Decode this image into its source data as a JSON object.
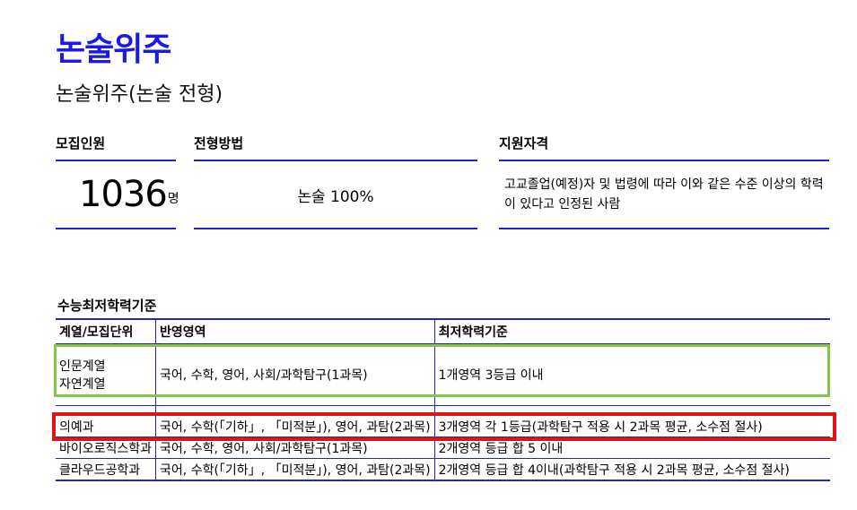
{
  "page": {
    "title": "논술위주",
    "subtitle": "논술위주(논술 전형)"
  },
  "summary": {
    "recruit_label": "모집인원",
    "recruit_count": "1036",
    "recruit_unit": "명",
    "method_label": "전형방법",
    "method_value": "논술 100%",
    "qualification_label": "지원자격",
    "qualification_value": "고교졸업(예정)자 및 법령에 따라 이와 같은 수준 이상의 학력이 있다고 인정된 사람"
  },
  "criteria": {
    "title": "수능최저학력기준",
    "headers": [
      "계열/모집단위",
      "반영영역",
      "최저학력기준"
    ],
    "rows": [
      {
        "unit_line1": "인문계열",
        "unit_line2": "자연계열",
        "areas": "국어, 수학, 영어, 사회/과학탐구(1과목)",
        "standard": "1개영역 3등급 이내"
      },
      {
        "unit": "의예과",
        "areas": "국어, 수학(「기하」, 「미적분」), 영어, 과탐(2과목)",
        "standard": "3개영역 각 1등급(과학탐구 적용 시 2과목 평균, 소수점 절사)"
      },
      {
        "unit": "바이오로직스학과",
        "areas": "국어, 수학, 영어, 사회/과학탐구(1과목)",
        "standard": "2개영역 등급 합 5 이내"
      },
      {
        "unit": "클라우드공학과",
        "areas": "국어, 수학(「기하」, 「미적분」), 영어, 과탐(2과목)",
        "standard": "2개영역 등급 합 4이내(과학탐구 적용 시 2과목 평균, 소수점 절사)"
      }
    ]
  },
  "highlight_colors": {
    "humanities_natural_box": "#84c44b",
    "medicine_box": "#e01414",
    "accent": "#1a1ae6"
  }
}
